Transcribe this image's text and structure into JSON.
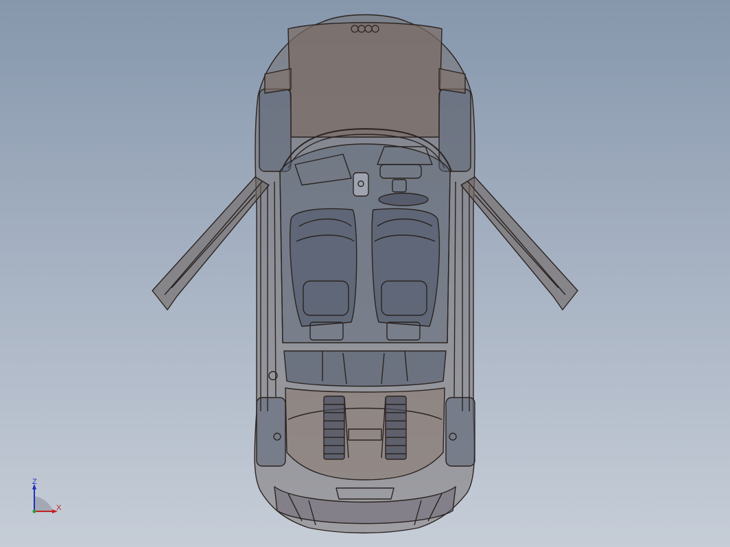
{
  "viewport": {
    "background_top": "#8697ac",
    "background_bottom": "#c6cdd7"
  },
  "model": {
    "subject": "car-top-view",
    "edge_color": "#2a2320",
    "body_tint": "#7d6e66",
    "glass_tint": "#5e6a80"
  },
  "triad": {
    "z_label": "Z",
    "x_label": "X",
    "z_color": "#1c2fbf",
    "x_color": "#c42222",
    "origin_color": "#2e9e3a"
  }
}
